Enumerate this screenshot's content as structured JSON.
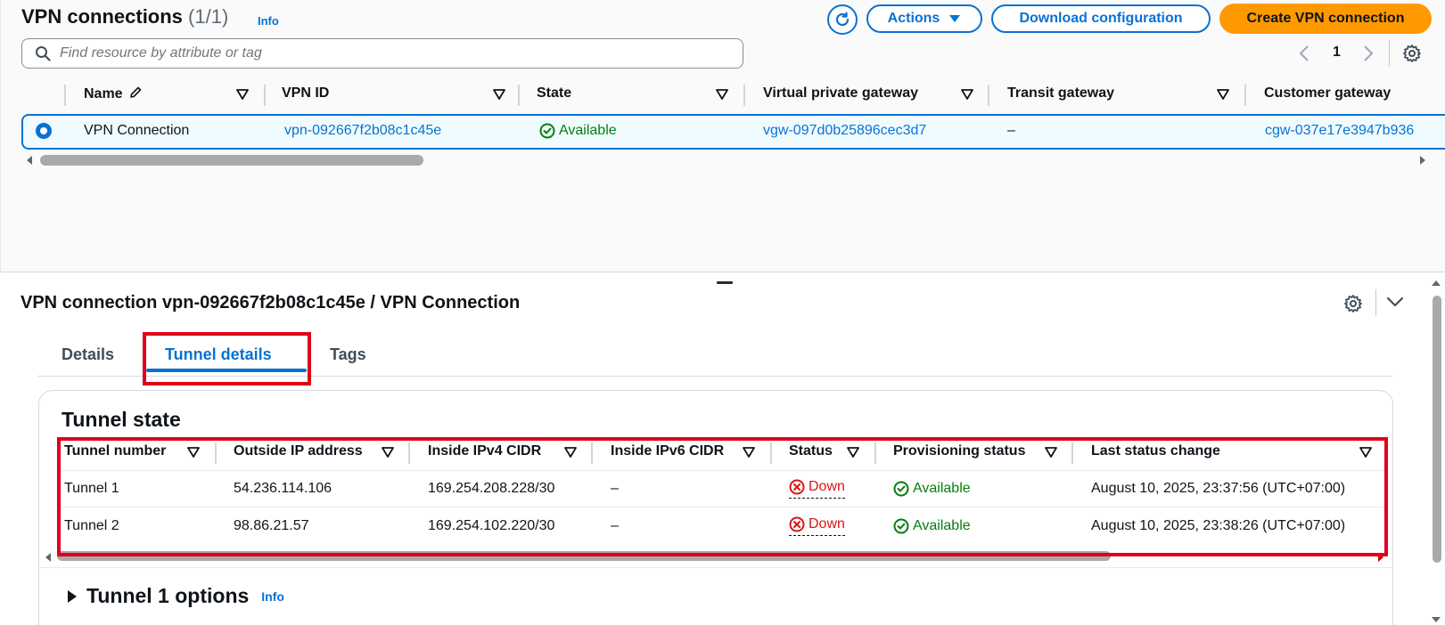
{
  "header": {
    "title": "VPN connections",
    "count": "(1/1)",
    "info": "Info",
    "actions_label": "Actions",
    "download_label": "Download configuration",
    "create_label": "Create VPN connection"
  },
  "search": {
    "placeholder": "Find resource by attribute or tag"
  },
  "pagination": {
    "current_page": "1"
  },
  "connections_table": {
    "columns": [
      "Name",
      "VPN ID",
      "State",
      "Virtual private gateway",
      "Transit gateway",
      "Customer gateway"
    ],
    "rows": [
      {
        "selected": true,
        "name": "VPN Connection",
        "vpn_id": "vpn-092667f2b08c1c45e",
        "state": "Available",
        "virtual_private_gateway": "vgw-097d0b25896cec3d7",
        "transit_gateway": "–",
        "customer_gateway": "cgw-037e17e3947b936"
      }
    ]
  },
  "detail": {
    "title": "VPN connection vpn-092667f2b08c1c45e / VPN Connection",
    "tabs": [
      "Details",
      "Tunnel details",
      "Tags"
    ],
    "active_tab": "Tunnel details",
    "tunnel_state": {
      "title": "Tunnel state",
      "columns": [
        "Tunnel number",
        "Outside IP address",
        "Inside IPv4 CIDR",
        "Inside IPv6 CIDR",
        "Status",
        "Provisioning status",
        "Last status change"
      ],
      "rows": [
        {
          "tunnel": "Tunnel 1",
          "outside_ip": "54.236.114.106",
          "inside_ipv4": "169.254.208.228/30",
          "inside_ipv6": "–",
          "status": "Down",
          "provisioning": "Available",
          "last_change": "August 10, 2025, 23:37:56 (UTC+07:00)"
        },
        {
          "tunnel": "Tunnel 2",
          "outside_ip": "98.86.21.57",
          "inside_ipv4": "169.254.102.220/30",
          "inside_ipv6": "–",
          "status": "Down",
          "provisioning": "Available",
          "last_change": "August 10, 2025, 23:38:26 (UTC+07:00)"
        }
      ]
    },
    "tunnel_options": {
      "title": "Tunnel 1 options",
      "info": "Info"
    }
  },
  "colors": {
    "accent": "#0972d3",
    "primary_button": "#ff9900",
    "success": "#037f0c",
    "error": "#d91515",
    "highlight": "#e0001a"
  },
  "icons": {
    "refresh": "refresh-icon",
    "dropdown": "caret-down-icon",
    "search": "search-icon",
    "settings": "gear-icon",
    "edit": "pencil-icon",
    "status_ok": "check-circle-icon",
    "status_error": "x-circle-icon"
  }
}
